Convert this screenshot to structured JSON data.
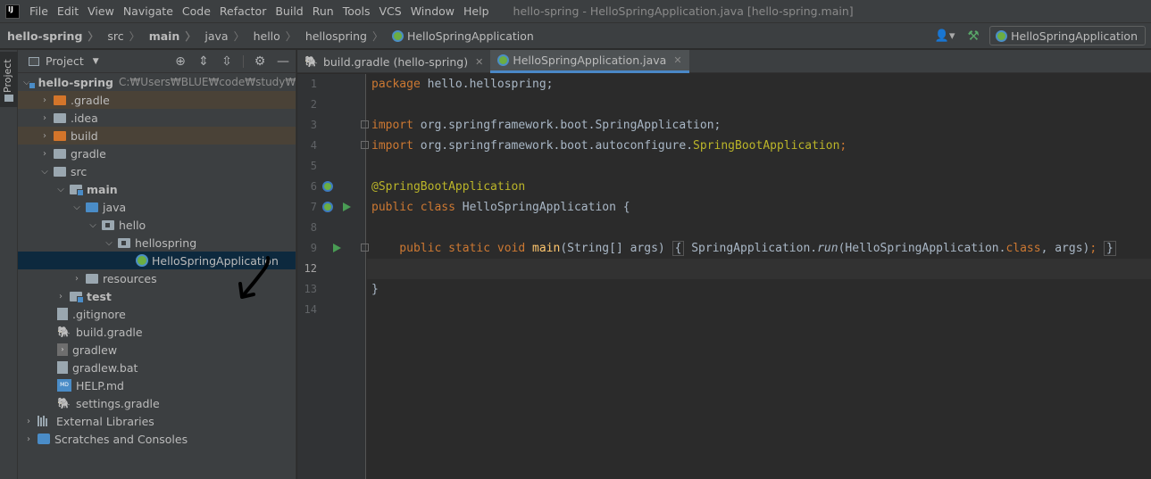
{
  "menu": {
    "logo": "IJ",
    "items": [
      "File",
      "Edit",
      "View",
      "Navigate",
      "Code",
      "Refactor",
      "Build",
      "Run",
      "Tools",
      "VCS",
      "Window",
      "Help"
    ],
    "window_title": "hello-spring - HelloSpringApplication.java [hello-spring.main]"
  },
  "breadcrumb": {
    "items": [
      "hello-spring",
      "src",
      "main",
      "java",
      "hello",
      "hellospring",
      "HelloSpringApplication"
    ]
  },
  "toolbar": {
    "run_config": "HelloSpringApplication",
    "user_icon": "user-icon",
    "build_icon": "hammer-icon"
  },
  "stripe": {
    "project_tab": "Project"
  },
  "project_panel": {
    "title": "Project",
    "tree": [
      {
        "label": "hello-spring",
        "path": "C:₩Users₩BLUE₩code₩study₩hello-"
      },
      {
        "label": ".gradle"
      },
      {
        "label": ".idea"
      },
      {
        "label": "build"
      },
      {
        "label": "gradle"
      },
      {
        "label": "src"
      },
      {
        "label": "main"
      },
      {
        "label": "java"
      },
      {
        "label": "hello"
      },
      {
        "label": "hellospring"
      },
      {
        "label": "HelloSpringApplication"
      },
      {
        "label": "resources"
      },
      {
        "label": "test"
      },
      {
        "label": ".gitignore"
      },
      {
        "label": "build.gradle"
      },
      {
        "label": "gradlew"
      },
      {
        "label": "gradlew.bat"
      },
      {
        "label": "HELP.md"
      },
      {
        "label": "settings.gradle"
      },
      {
        "label": "External Libraries"
      },
      {
        "label": "Scratches and Consoles"
      }
    ]
  },
  "editor": {
    "tabs": [
      {
        "label": "build.gradle (hello-spring)"
      },
      {
        "label": "HelloSpringApplication.java"
      }
    ],
    "line_numbers": [
      "1",
      "2",
      "3",
      "4",
      "5",
      "6",
      "7",
      "8",
      "9",
      "12",
      "13",
      "14"
    ],
    "code": {
      "l1_kw": "package",
      "l1_rest": " hello.hellospring;",
      "l3_kw": "import",
      "l3_rest": " org.springframework.boot.SpringApplication;",
      "l4_kw": "import",
      "l4_rest": " org.springframework.boot.autoconfigure.",
      "l4_ann": "SpringBootApplication",
      "l4_end": ";",
      "l6_ann": "@SpringBootApplication",
      "l7_kw": "public class",
      "l7_rest": " HelloSpringApplication {",
      "l9_kw": "    public static void",
      "l9_fn": " main",
      "l9_args": "(String[] args) ",
      "l9_fold_open": "{",
      "l9_body1": " SpringApplication.",
      "l9_run": "run",
      "l9_body2": "(HelloSpringApplication.",
      "l9_class": "class",
      "l9_body3": ", args)",
      "l9_semi": ";",
      "l9_fold_close": "}",
      "l13": "}"
    }
  }
}
